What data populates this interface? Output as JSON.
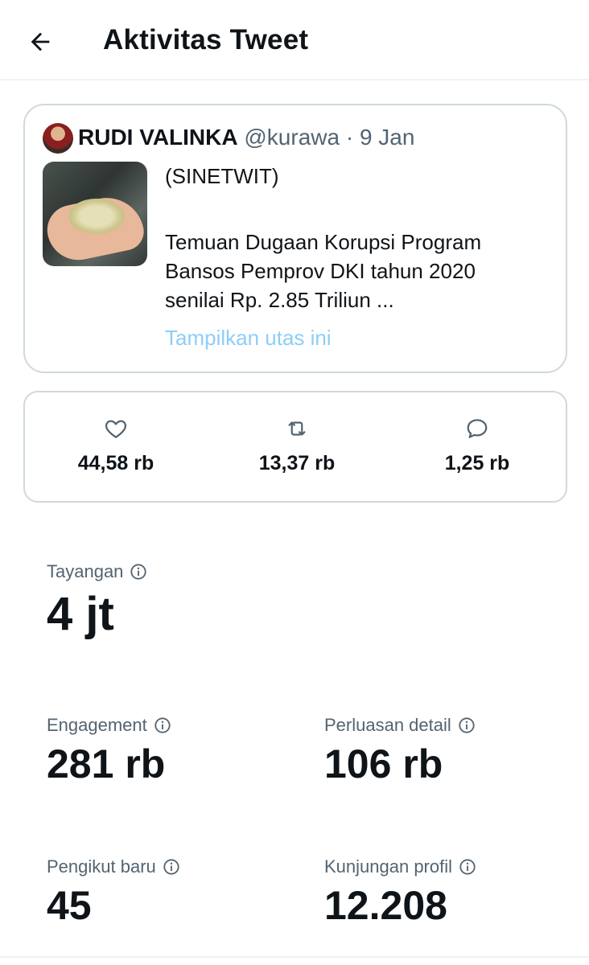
{
  "header": {
    "title": "Aktivitas Tweet"
  },
  "tweet": {
    "author_name": "RUDI VALINKA",
    "author_handle": "@kurawa",
    "separator": "·",
    "date": "9 Jan",
    "text_line1": "(SINETWIT)",
    "text_line2": "Temuan Dugaan Korupsi Program",
    "text_line3": "Bansos Pemprov DKI tahun 2020",
    "text_line4": "senilai Rp. 2.85 Triliun ...",
    "show_thread": "Tampilkan utas ini"
  },
  "engagement_counts": {
    "likes": "44,58 rb",
    "retweets": "13,37 rb",
    "replies": "1,25 rb"
  },
  "metrics": {
    "impressions": {
      "label": "Tayangan",
      "value": "4 jt"
    },
    "engagements": {
      "label": "Engagement",
      "value": "281 rb"
    },
    "detail_expands": {
      "label": "Perluasan detail",
      "value": "106 rb"
    },
    "new_followers": {
      "label": "Pengikut baru",
      "value": "45"
    },
    "profile_visits": {
      "label": "Kunjungan profil",
      "value": "12.208"
    }
  },
  "colors": {
    "text_primary": "#0f1419",
    "text_secondary": "#536471",
    "link": "#8ecdf8",
    "border": "#cfd9de"
  },
  "icons": {
    "back": "arrow-left-icon",
    "like": "heart-icon",
    "retweet": "retweet-icon",
    "reply": "reply-icon",
    "info": "info-icon"
  }
}
